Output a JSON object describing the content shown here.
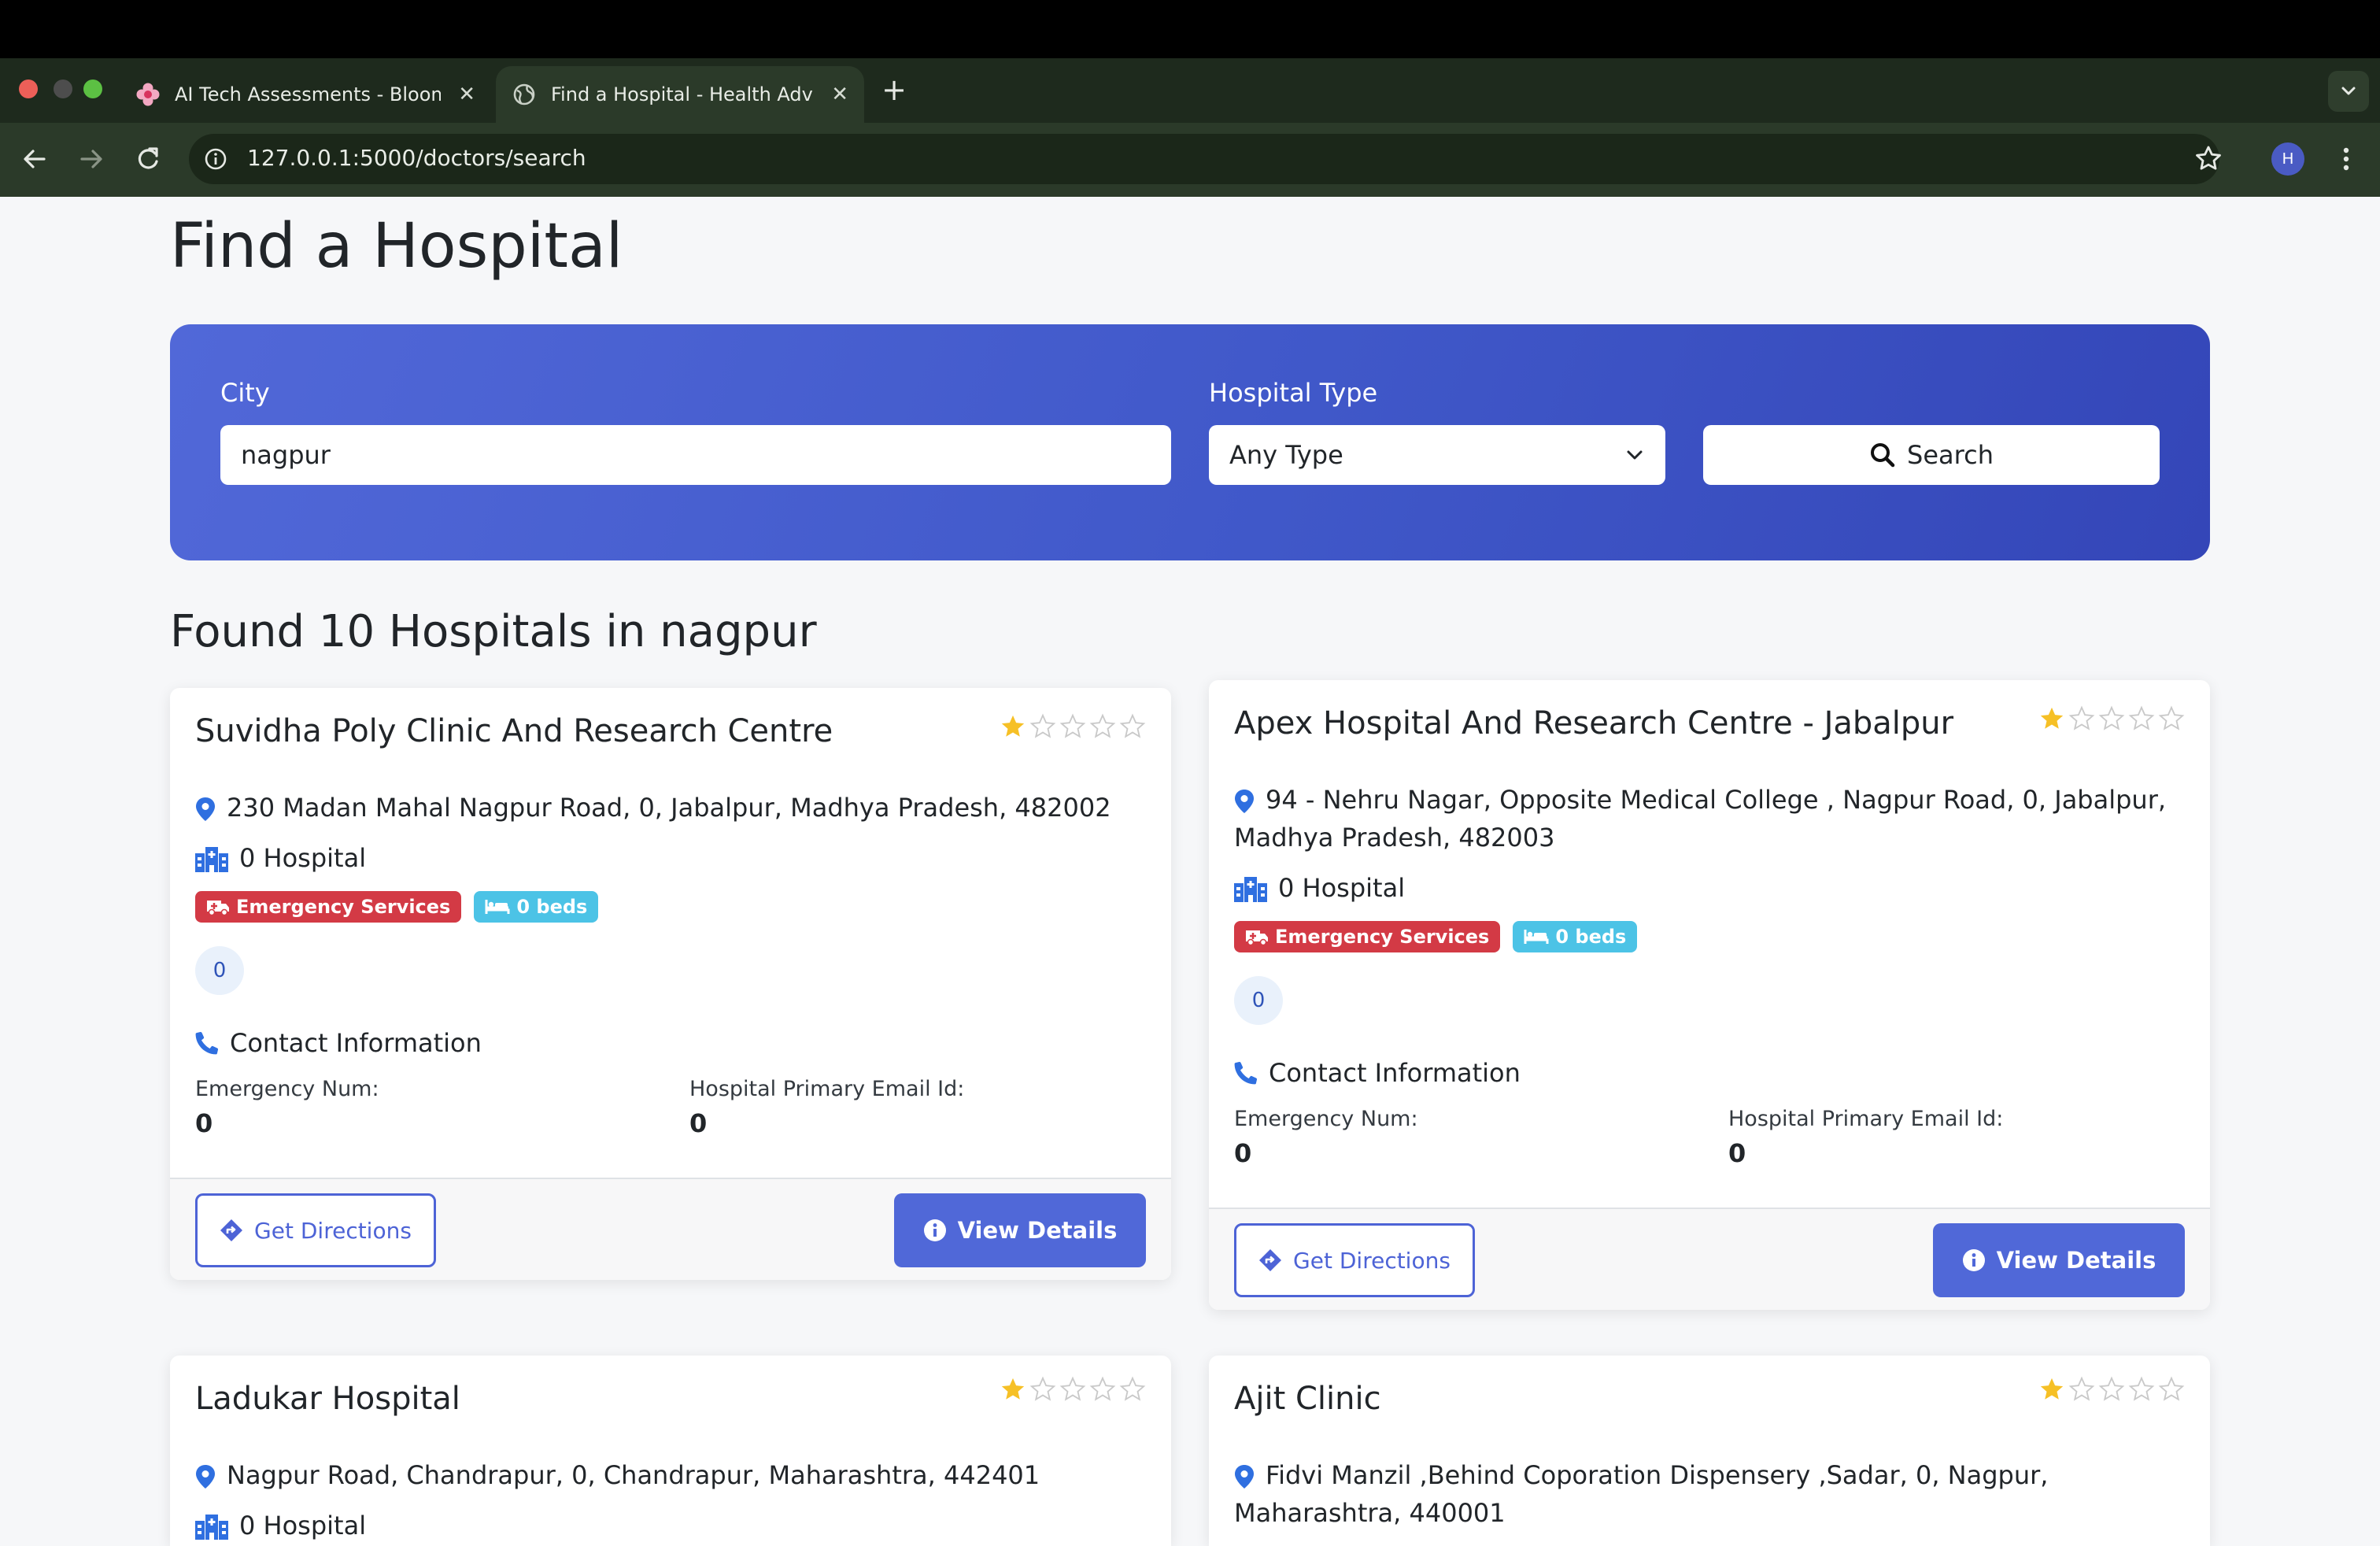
{
  "browser": {
    "tabs": [
      {
        "title": "AI Tech Assessments - Bloom",
        "close": "✕"
      },
      {
        "title": "Find a Hospital - Health Advisor",
        "close": "✕"
      }
    ],
    "new_tab": "+",
    "url": "127.0.0.1:5000/doctors/search",
    "profile_initial": "H"
  },
  "page": {
    "title": "Find a Hospital",
    "search": {
      "city_label": "City",
      "city_value": "nagpur",
      "type_label": "Hospital Type",
      "type_selected": "Any Type",
      "search_button": "Search"
    },
    "results_heading": "Found 10 Hospitals in nagpur"
  },
  "hospitals": [
    {
      "name": "Suvidha Poly Clinic And Research Centre",
      "rating": 1,
      "address": "230 Madan Mahal Nagpur Road, 0, Jabalpur, Madhya Pradesh, 482002",
      "type": "0 Hospital",
      "badges": {
        "emergency": "Emergency Services",
        "beds": "0 beds"
      },
      "count": "0",
      "contact_heading": "Contact Information",
      "emergency_label": "Emergency Num:",
      "emergency_value": "0",
      "email_label": "Hospital Primary Email Id:",
      "email_value": "0",
      "directions": "Get Directions",
      "details": "View Details"
    },
    {
      "name": "Apex Hospital And Research Centre - Jabalpur",
      "rating": 1,
      "address": "94 - Nehru Nagar, Opposite Medical College , Nagpur Road, 0, Jabalpur, Madhya Pradesh, 482003",
      "type": "0 Hospital",
      "badges": {
        "emergency": "Emergency Services",
        "beds": "0 beds"
      },
      "count": "0",
      "contact_heading": "Contact Information",
      "emergency_label": "Emergency Num:",
      "emergency_value": "0",
      "email_label": "Hospital Primary Email Id:",
      "email_value": "0",
      "directions": "Get Directions",
      "details": "View Details"
    },
    {
      "name": "Ladukar Hospital",
      "rating": 1,
      "address": "Nagpur Road, Chandrapur, 0, Chandrapur, Maharashtra, 442401",
      "type": "0 Hospital"
    },
    {
      "name": "Ajit Clinic",
      "rating": 1,
      "address": "Fidvi Manzil ,Behind Coporation Dispensery ,Sadar, 0, Nagpur, Maharashtra, 440001",
      "type": ""
    }
  ],
  "colors": {
    "accent": "#5068d8",
    "panel_gradient_start": "#5168d8",
    "panel_gradient_end": "#3446b8",
    "emergency_badge": "#d33a45",
    "beds_badge": "#4cc3e6",
    "star": "#f6c026",
    "icon_blue": "#2f6fe0"
  }
}
